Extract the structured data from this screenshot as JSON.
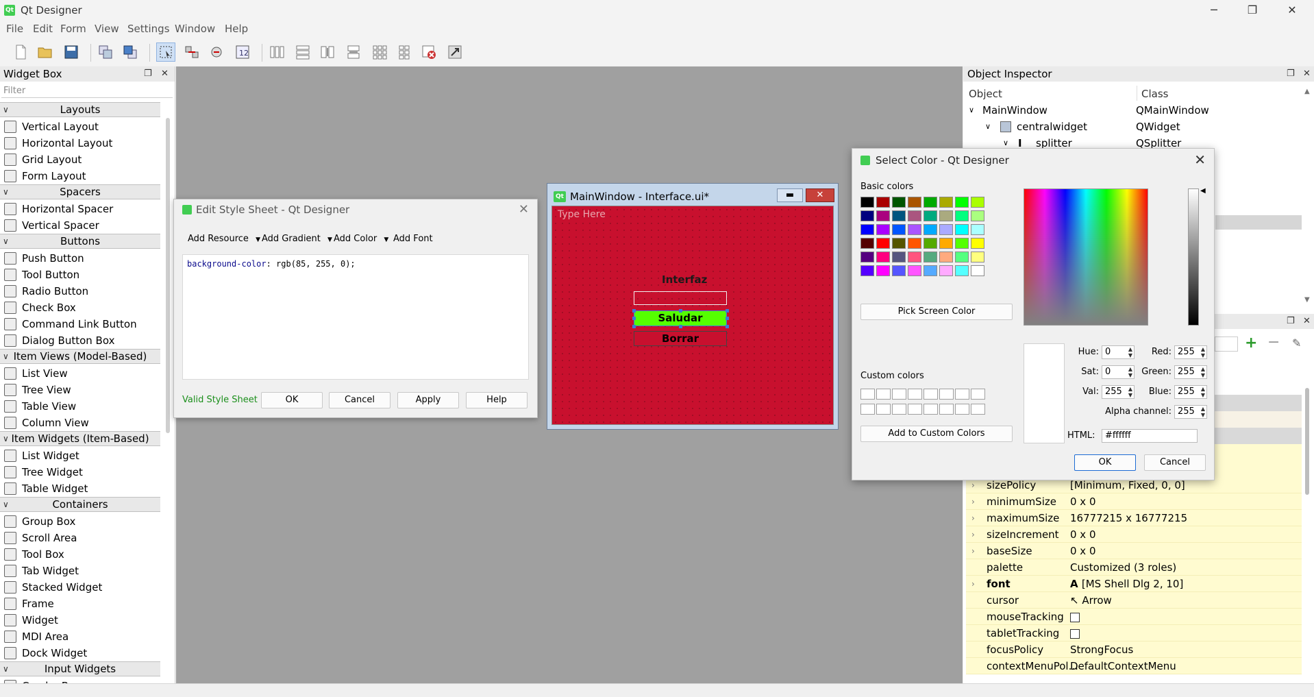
{
  "window": {
    "title": "Qt Designer",
    "app_icon": "qt-icon"
  },
  "menu": [
    "File",
    "Edit",
    "Form",
    "View",
    "Settings",
    "Window",
    "Help"
  ],
  "widget_box": {
    "title": "Widget Box",
    "filter_placeholder": "Filter",
    "categories": [
      {
        "label": "Layouts",
        "items": [
          "Vertical Layout",
          "Horizontal Layout",
          "Grid Layout",
          "Form Layout"
        ]
      },
      {
        "label": "Spacers",
        "items": [
          "Horizontal Spacer",
          "Vertical Spacer"
        ]
      },
      {
        "label": "Buttons",
        "items": [
          "Push Button",
          "Tool Button",
          "Radio Button",
          "Check Box",
          "Command Link Button",
          "Dialog Button Box"
        ]
      },
      {
        "label": "Item Views (Model-Based)",
        "items": [
          "List View",
          "Tree View",
          "Table View",
          "Column View"
        ]
      },
      {
        "label": "Item Widgets (Item-Based)",
        "items": [
          "List Widget",
          "Tree Widget",
          "Table Widget"
        ]
      },
      {
        "label": "Containers",
        "items": [
          "Group Box",
          "Scroll Area",
          "Tool Box",
          "Tab Widget",
          "Stacked Widget",
          "Frame",
          "Widget",
          "MDI Area",
          "Dock Widget"
        ]
      },
      {
        "label": "Input Widgets",
        "items": [
          "Combo Box"
        ]
      }
    ]
  },
  "stylesheet_dialog": {
    "title": "Edit Style Sheet - Qt Designer",
    "toolbar": [
      "Add Resource",
      "Add Gradient",
      "Add Color",
      "Add Font"
    ],
    "css_property": "background-color",
    "css_value": ": rgb(85, 255, 0);",
    "status": "Valid Style Sheet",
    "buttons": [
      "OK",
      "Cancel",
      "Apply",
      "Help"
    ]
  },
  "form": {
    "title": "MainWindow - Interface.ui*",
    "menu_placeholder": "Type Here",
    "label": "Interfaz",
    "button1": "Saludar",
    "button2": "Borrar",
    "background_color": "#c8102e",
    "button1_color": "#55ff00"
  },
  "object_inspector": {
    "title": "Object Inspector",
    "col_object": "Object",
    "col_class": "Class",
    "rows": [
      {
        "object": "MainWindow",
        "class": "QMainWindow"
      },
      {
        "object": "centralwidget",
        "class": "QWidget"
      },
      {
        "object": "splitter",
        "class": "QSplitter"
      }
    ]
  },
  "properties": [
    {
      "name": "sizePolicy",
      "value": "[Minimum, Fixed, 0, 0]",
      "expand": true
    },
    {
      "name": "minimumSize",
      "value": "0 x 0",
      "expand": true
    },
    {
      "name": "maximumSize",
      "value": "16777215 x 16777215",
      "expand": true
    },
    {
      "name": "sizeIncrement",
      "value": "0 x 0",
      "expand": true
    },
    {
      "name": "baseSize",
      "value": "0 x 0",
      "expand": true
    },
    {
      "name": "palette",
      "value": "Customized (3 roles)",
      "expand": false
    },
    {
      "name": "font",
      "value": "[MS Shell Dlg 2, 10]",
      "expand": true
    },
    {
      "name": "cursor",
      "value": "Arrow",
      "expand": false
    },
    {
      "name": "mouseTracking",
      "value": "",
      "expand": false
    },
    {
      "name": "tabletTracking",
      "value": "",
      "expand": false
    },
    {
      "name": "focusPolicy",
      "value": "StrongFocus",
      "expand": false
    },
    {
      "name": "contextMenuPol...",
      "value": "DefaultContextMenu",
      "expand": false
    }
  ],
  "color_dialog": {
    "title": "Select Color - Qt Designer",
    "basic_label": "Basic colors",
    "custom_label": "Custom colors",
    "pick_screen": "Pick Screen Color",
    "add_custom": "Add to Custom Colors",
    "basic_colors": [
      [
        "#000000",
        "#aa0000",
        "#005500",
        "#aa5500",
        "#00aa00",
        "#aaaa00",
        "#00ff00",
        "#aaff00"
      ],
      [
        "#00007f",
        "#aa007f",
        "#00557f",
        "#aa557f",
        "#00aa7f",
        "#aaaa7f",
        "#00ff7f",
        "#aaff7f"
      ],
      [
        "#0000ff",
        "#aa00ff",
        "#0055ff",
        "#aa55ff",
        "#00aaff",
        "#aaaaff",
        "#00ffff",
        "#aaffff"
      ],
      [
        "#550000",
        "#ff0000",
        "#555500",
        "#ff5500",
        "#55aa00",
        "#ffaa00",
        "#55ff00",
        "#ffff00"
      ],
      [
        "#55007f",
        "#ff007f",
        "#55557f",
        "#ff557f",
        "#55aa7f",
        "#ffaa7f",
        "#55ff7f",
        "#ffff7f"
      ],
      [
        "#5500ff",
        "#ff00ff",
        "#5555ff",
        "#ff55ff",
        "#55aaff",
        "#ffaaff",
        "#55ffff",
        "#ffffff"
      ]
    ],
    "fields": {
      "hue_label": "Hue:",
      "hue": "0",
      "sat_label": "Sat:",
      "sat": "0",
      "val_label": "Val:",
      "val": "255",
      "red_label": "Red:",
      "red": "255",
      "green_label": "Green:",
      "green": "255",
      "blue_label": "Blue:",
      "blue": "255",
      "alpha_label": "Alpha channel:",
      "alpha": "255",
      "html_label": "HTML:",
      "html": "#ffffff"
    },
    "ok": "OK",
    "cancel": "Cancel"
  }
}
